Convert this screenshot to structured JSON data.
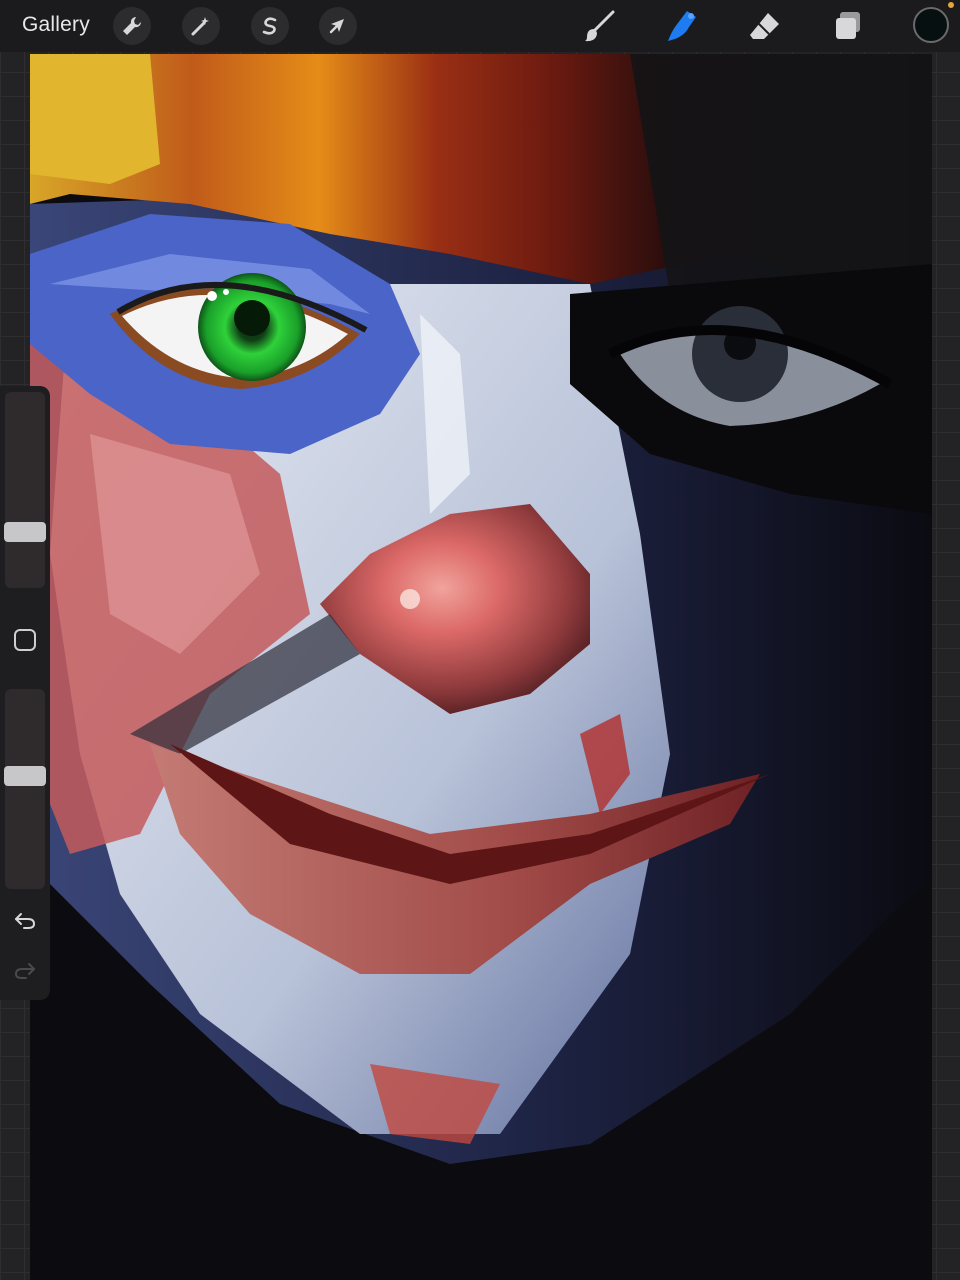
{
  "toolbar": {
    "gallery_label": "Gallery",
    "actions": [
      {
        "name": "actions",
        "icon": "wrench-icon"
      },
      {
        "name": "adjustments",
        "icon": "magic-wand-icon"
      },
      {
        "name": "selection",
        "icon": "selection-s-icon"
      },
      {
        "name": "transform",
        "icon": "arrow-cursor-icon"
      }
    ],
    "tools": [
      {
        "name": "paint",
        "icon": "brush-icon",
        "active": false
      },
      {
        "name": "smudge",
        "icon": "smudge-finger-icon",
        "active": true
      },
      {
        "name": "erase",
        "icon": "eraser-icon",
        "active": false
      },
      {
        "name": "layers",
        "icon": "layers-icon",
        "active": false
      }
    ],
    "current_color": "#071010",
    "active_tool_color": "#1e7cf2"
  },
  "sidebar": {
    "brush_size_level": 0.26,
    "opacity_level": 0.57,
    "modify_icon": "square-icon",
    "undo_icon": "undo-icon",
    "redo_icon": "redo-icon"
  },
  "canvas": {
    "subject": "clown-face-painting",
    "eye_color": "#2fd13a"
  }
}
